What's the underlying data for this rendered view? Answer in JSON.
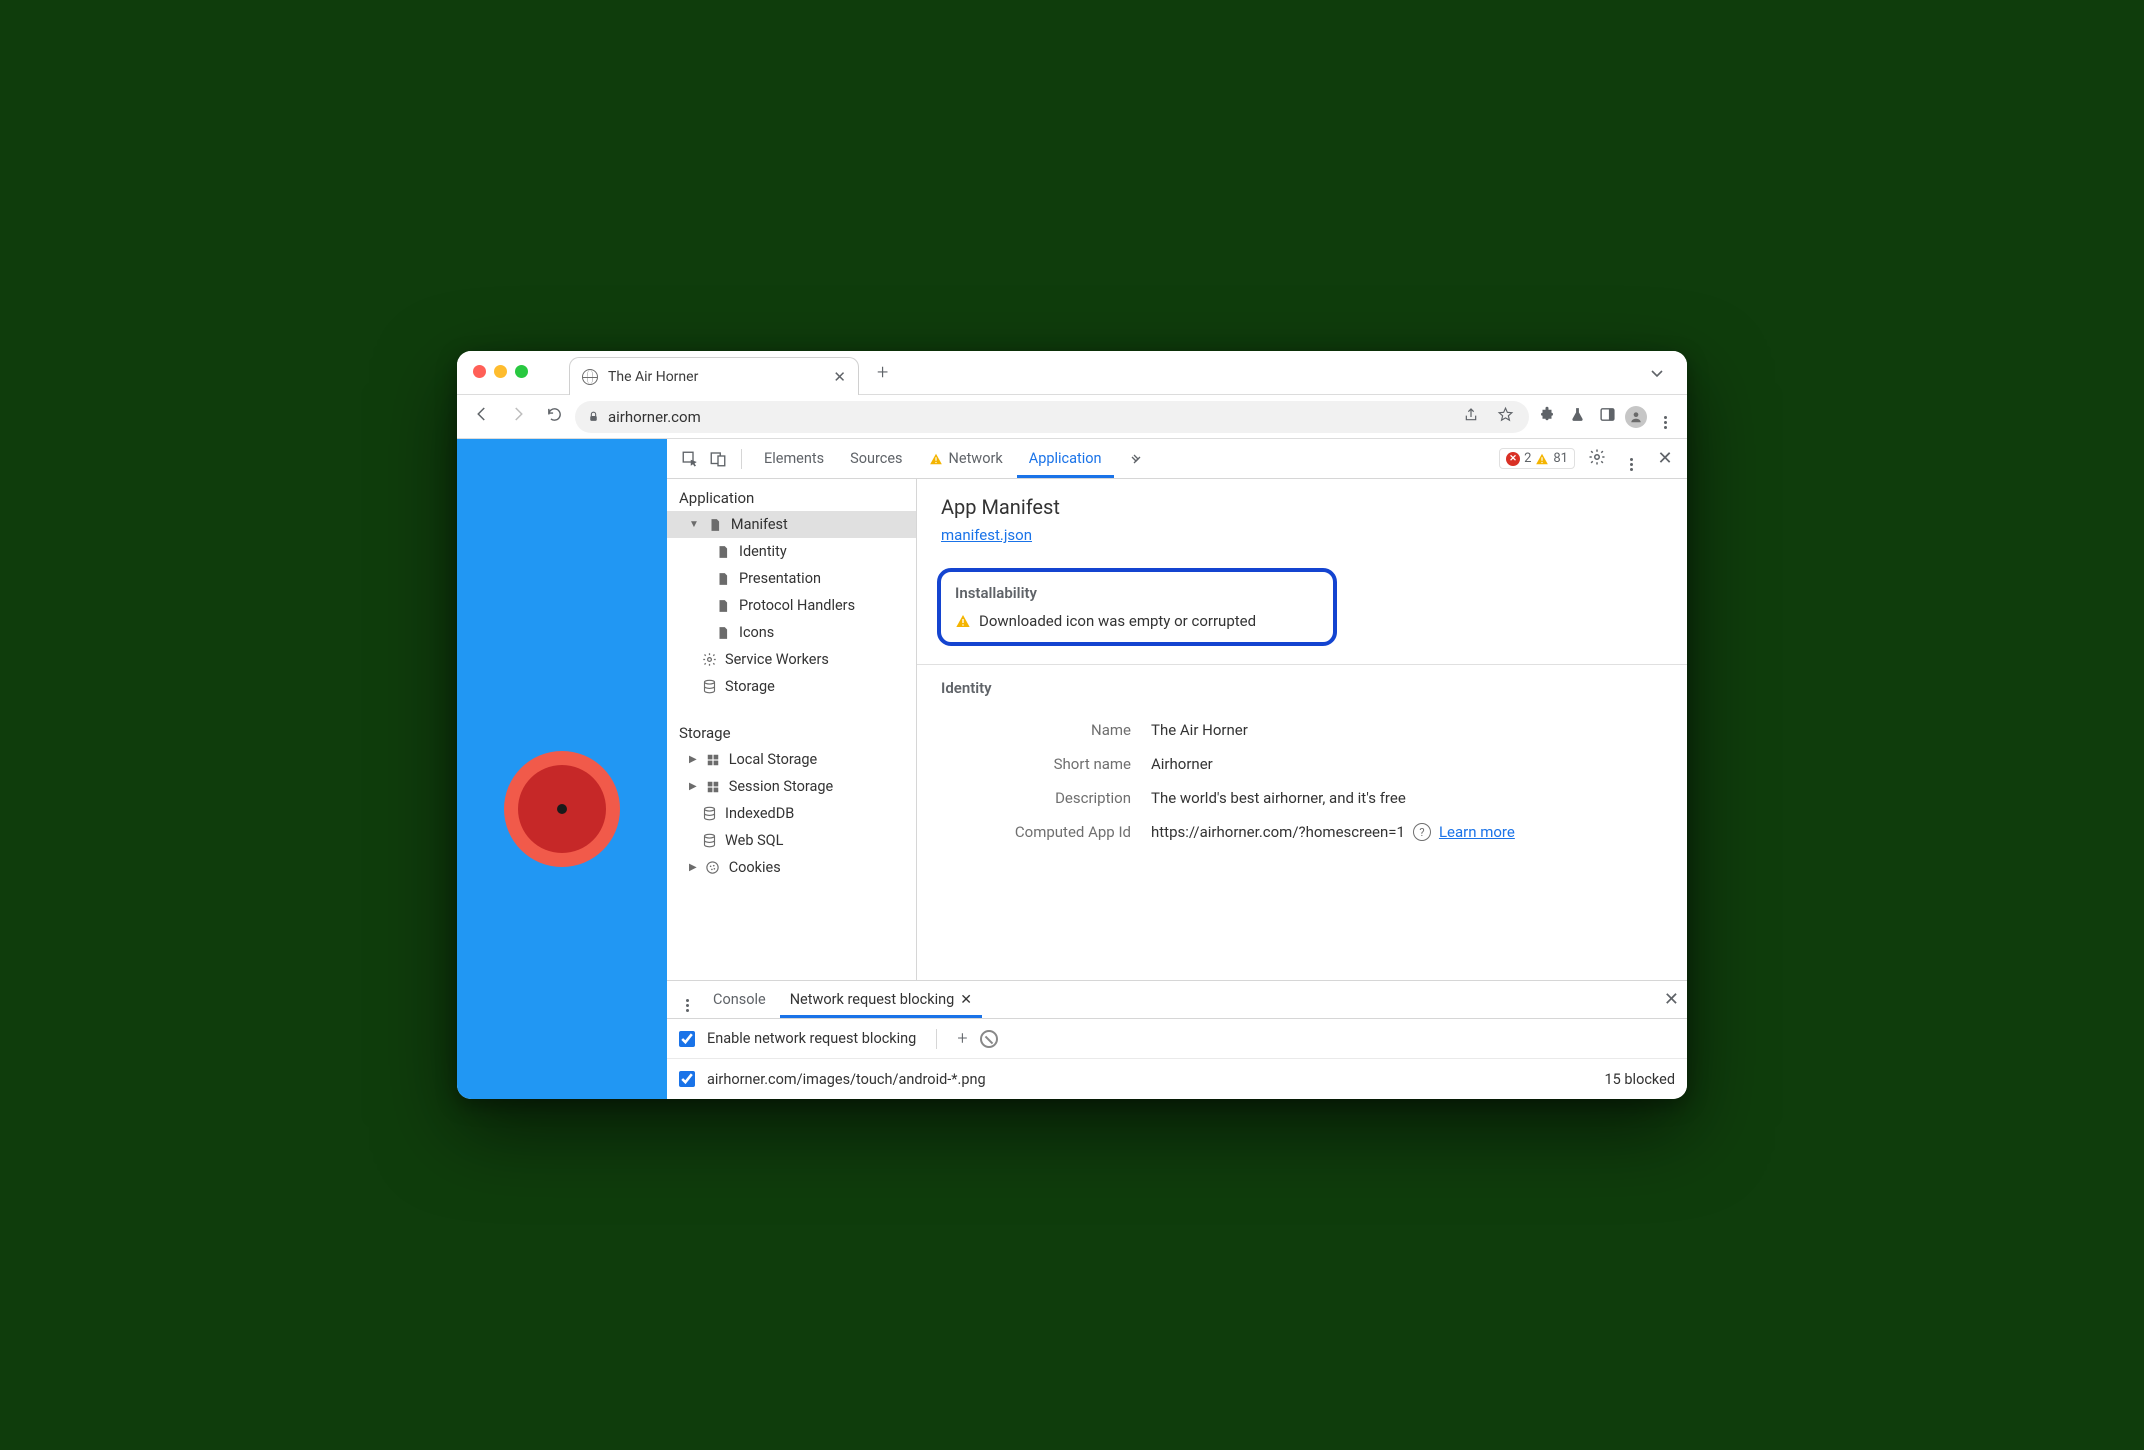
{
  "tab": {
    "title": "The Air Horner"
  },
  "address": {
    "url": "airhorner.com"
  },
  "devtools_tabs": {
    "elements": "Elements",
    "sources": "Sources",
    "network": "Network",
    "application": "Application"
  },
  "alerts": {
    "errors": "2",
    "warnings": "81"
  },
  "sidebar": {
    "application_title": "Application",
    "manifest": "Manifest",
    "identity": "Identity",
    "presentation": "Presentation",
    "protocol_handlers": "Protocol Handlers",
    "icons": "Icons",
    "service_workers": "Service Workers",
    "storage_app": "Storage",
    "storage_title": "Storage",
    "local_storage": "Local Storage",
    "session_storage": "Session Storage",
    "indexeddb": "IndexedDB",
    "websql": "Web SQL",
    "cookies": "Cookies"
  },
  "manifest": {
    "title": "App Manifest",
    "link": "manifest.json",
    "install_title": "Installability",
    "install_msg": "Downloaded icon was empty or corrupted",
    "identity_title": "Identity",
    "name_label": "Name",
    "name_val": "The Air Horner",
    "short_label": "Short name",
    "short_val": "Airhorner",
    "desc_label": "Description",
    "desc_val": "The world's best airhorner, and it's free",
    "appid_label": "Computed App Id",
    "appid_val": "https://airhorner.com/?homescreen=1",
    "learn_more": "Learn more"
  },
  "drawer": {
    "console": "Console",
    "nrb": "Network request blocking",
    "enable": "Enable network request blocking",
    "pattern": "airhorner.com/images/touch/android-*.png",
    "blocked": "15 blocked"
  }
}
